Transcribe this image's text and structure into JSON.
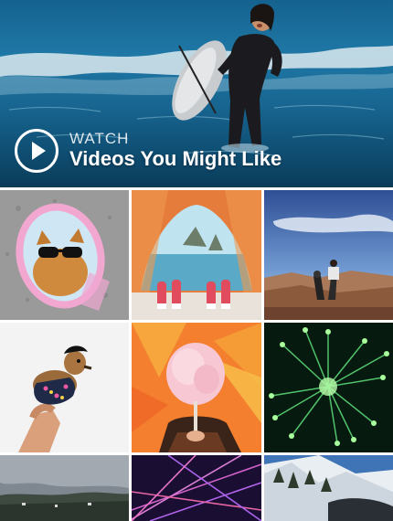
{
  "hero": {
    "watch_label": "WATCH",
    "title": "Videos You Might Like",
    "play_icon": "play-icon"
  },
  "grid": {
    "tiles": [
      {
        "name": "cat-sunglasses-mirror"
      },
      {
        "name": "tent-ocean-view"
      },
      {
        "name": "canyon-proposal"
      },
      {
        "name": "dog-held-up"
      },
      {
        "name": "cotton-candy"
      },
      {
        "name": "green-fireworks"
      },
      {
        "name": "cloudy-hills"
      },
      {
        "name": "laser-lights"
      },
      {
        "name": "snowy-mountain"
      }
    ]
  }
}
